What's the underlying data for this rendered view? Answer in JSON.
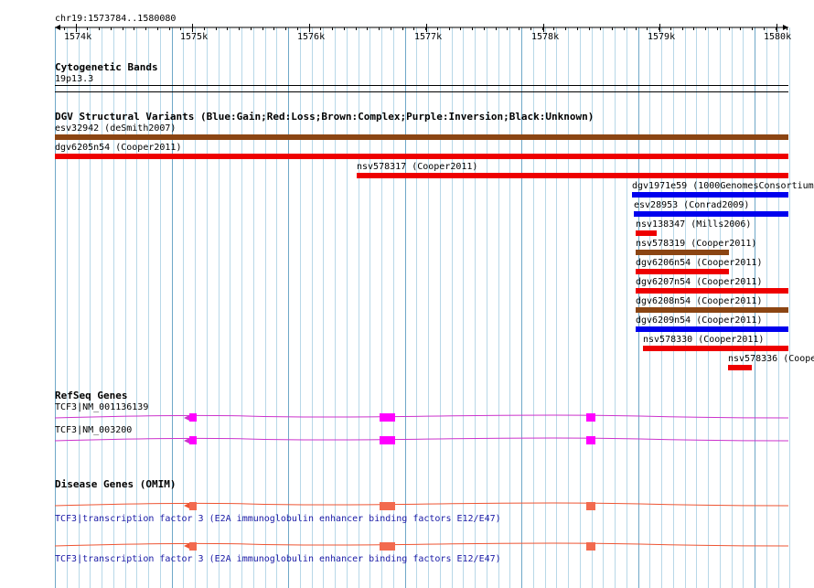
{
  "ruler": {
    "locus": "chr19:1573784..1580080",
    "ticks": [
      "1574k",
      "1575k",
      "1576k",
      "1577k",
      "1578k",
      "1579k",
      "1580k"
    ]
  },
  "cytoband": {
    "title": "Cytogenetic Bands",
    "band": "19p13.3"
  },
  "dgv": {
    "title": "DGV Structural Variants (Blue:Gain;Red:Loss;Brown:Complex;Purple:Inversion;Black:Unknown)",
    "colors": {
      "gain": "#0000ee",
      "loss": "#ee0000",
      "complex": "#8b4513"
    },
    "variants": [
      {
        "label": "esv32942 (deSmith2007)",
        "type": "complex"
      },
      {
        "label": "dgv6205n54 (Cooper2011)",
        "type": "loss"
      },
      {
        "label": "nsv578317 (Cooper2011)",
        "type": "loss"
      },
      {
        "label": "dgv1971e59 (1000GenomesConsortiumP",
        "type": "gain"
      },
      {
        "label": "esv28953 (Conrad2009)",
        "type": "gain"
      },
      {
        "label": "nsv138347 (Mills2006)",
        "type": "loss"
      },
      {
        "label": "nsv578319 (Cooper2011)",
        "type": "complex"
      },
      {
        "label": "dgv6206n54 (Cooper2011)",
        "type": "loss"
      },
      {
        "label": "dgv6207n54 (Cooper2011)",
        "type": "loss"
      },
      {
        "label": "dgv6208n54 (Cooper2011)",
        "type": "complex"
      },
      {
        "label": "dgv6209n54 (Cooper2011)",
        "type": "gain"
      },
      {
        "label": "nsv578330 (Cooper2011)",
        "type": "loss"
      },
      {
        "label": "nsv578336 (Coope",
        "type": "loss"
      }
    ]
  },
  "refseq": {
    "title": "RefSeq Genes",
    "color": "#cc33cc",
    "exon_color": "#ff00ff",
    "genes": [
      {
        "label": "TCF3|NM_001136139"
      },
      {
        "label": "TCF3|NM_003200"
      }
    ]
  },
  "omim": {
    "title": "Disease Genes (OMIM)",
    "color": "#ee5533",
    "exon_color": "#f26a4f",
    "genes": [
      {
        "label": "TCF3|transcription factor 3 (E2A immunoglobulin enhancer binding factors E12/E47)"
      },
      {
        "label": "TCF3|transcription factor 3 (E2A immunoglobulin enhancer binding factors E12/E47)"
      }
    ]
  }
}
